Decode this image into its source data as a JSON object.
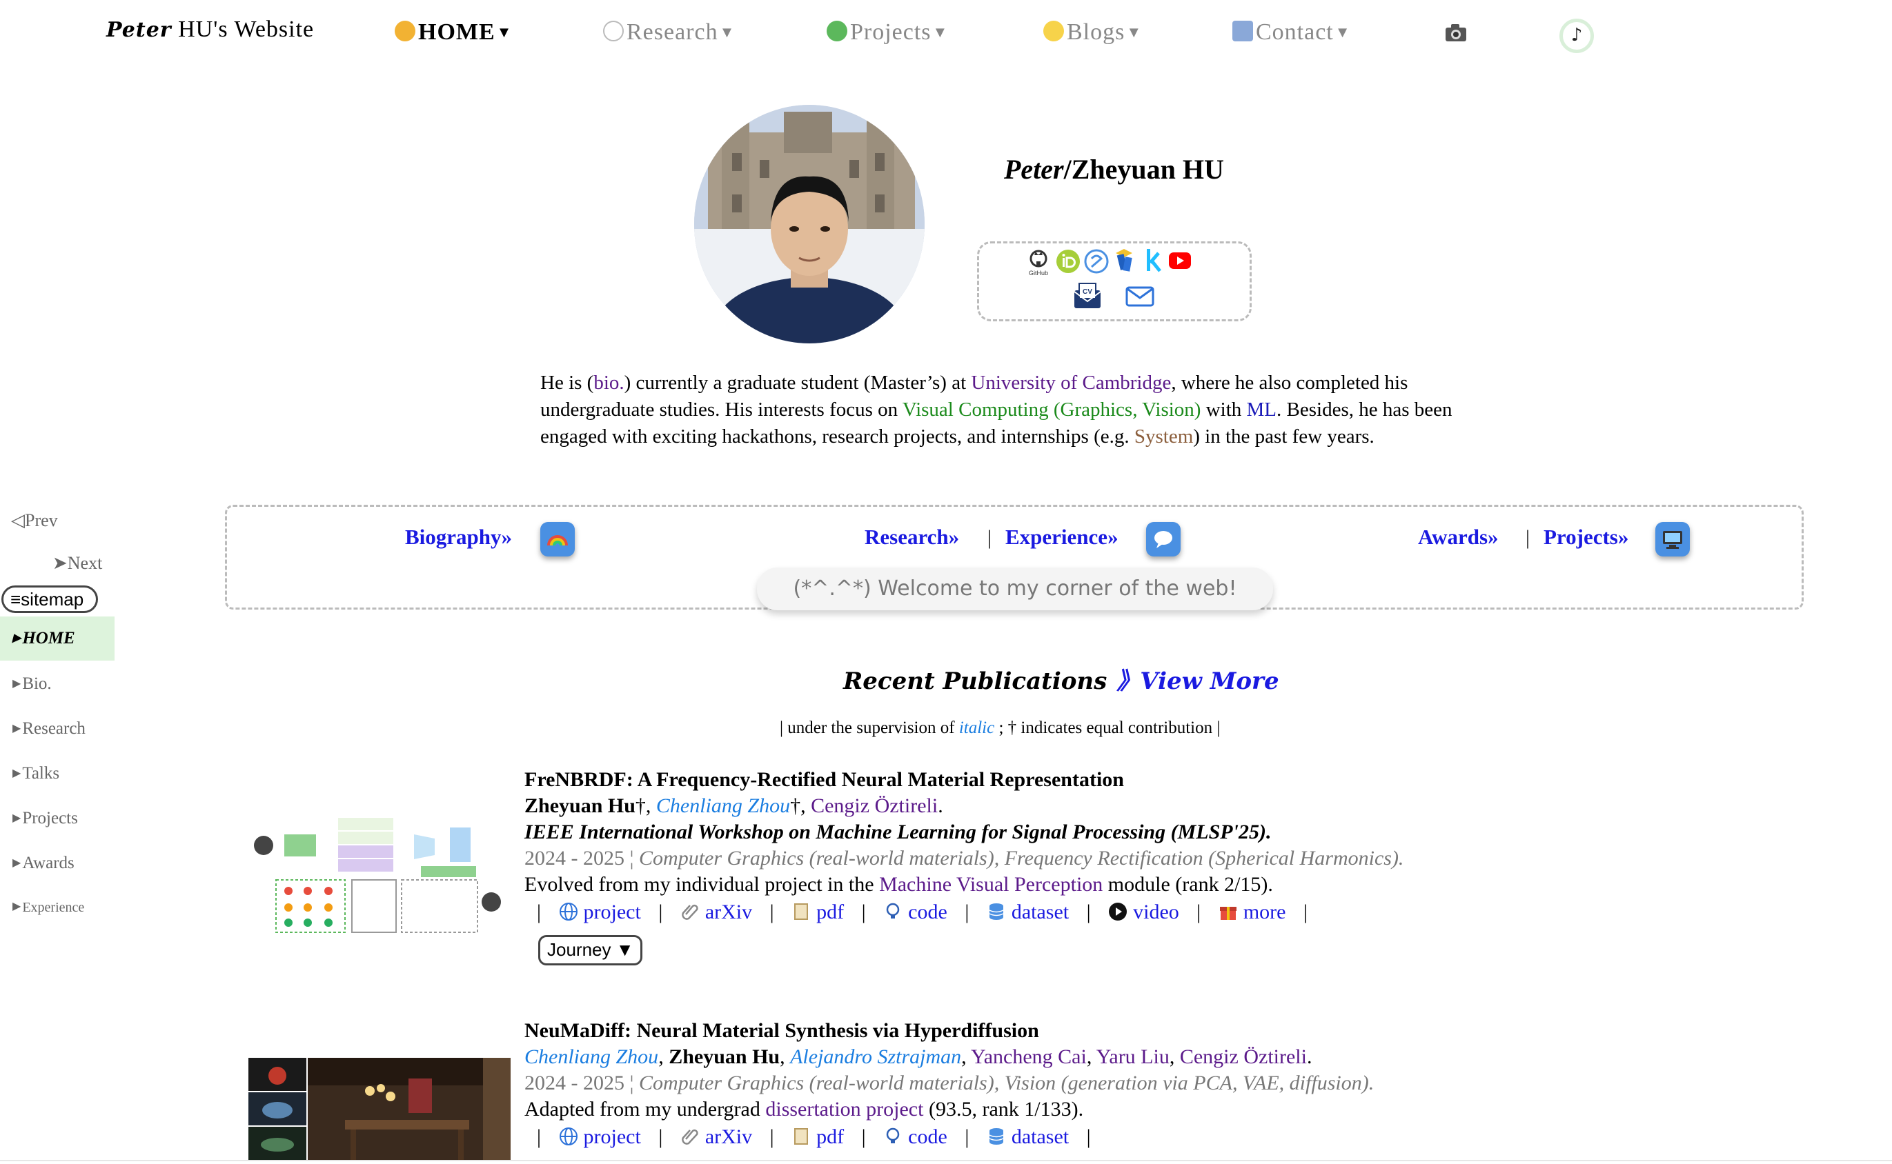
{
  "nav": {
    "brand_first": "Peter",
    "brand_rest": " HU's Website",
    "items": [
      {
        "label": "HOME"
      },
      {
        "label": "Research"
      },
      {
        "label": "Projects"
      },
      {
        "label": "Blogs"
      },
      {
        "label": "Contact"
      }
    ],
    "music_glyph": "♪"
  },
  "sidebar": {
    "prev": "◁Prev",
    "next": "➤Next",
    "sitemap": "≡sitemap",
    "items": [
      {
        "label": "HOME"
      },
      {
        "label": "Bio."
      },
      {
        "label": "Research"
      },
      {
        "label": "Talks"
      },
      {
        "label": "Projects"
      },
      {
        "label": "Awards"
      },
      {
        "label": "Experience"
      }
    ]
  },
  "profile": {
    "name_italic": "Peter",
    "name_rest": "/Zheyuan HU",
    "github_caption": "GitHub"
  },
  "bio": {
    "p1": "He is (",
    "bio_link": "bio.",
    "p2": ") currently a graduate student (Master’s) at ",
    "uni_link": "University of Cambridge",
    "p3": ", where he also completed his undergraduate studies. His interests focus on ",
    "vc_link": "Visual Computing (Graphics, Vision)",
    "p4": " with ",
    "ml_link": "ML",
    "p5": ". Besides, he has been engaged with exciting hackathons, research projects, and internships (e.g. ",
    "sys_link": "System",
    "p6": ") in the past few years."
  },
  "sections": {
    "biography": "Biography»",
    "research": "Research»",
    "experience": "Experience»",
    "awards": "Awards»",
    "projects": "Projects»",
    "separator": "|",
    "welcome": "(*^.^*) Welcome to my corner of the web!"
  },
  "publications": {
    "heading": "Recent Publications",
    "view_more": "》View More",
    "note_pre": "| under the supervision of ",
    "note_italic": "italic",
    "note_post": " ; † indicates equal contribution |",
    "items": [
      {
        "title": "FreNBRDF: A Frequency-Rectified Neural Material Representation",
        "authors": [
          {
            "name": "Zheyuan Hu",
            "style": "self"
          },
          {
            "name": "Chenliang Zhou",
            "style": "italic"
          },
          {
            "name": "Cengiz Öztireli",
            "style": "plain"
          }
        ],
        "venue": "IEEE International Workshop on Machine Learning for Signal Processing (MLSP'25).",
        "years": "2024 - 2025",
        "topics": "Computer Graphics (real-world materials), Frequency Rectification (Spherical Harmonics).",
        "desc_pre": "Evolved from my individual project in the ",
        "desc_link": "Machine Visual Perception",
        "desc_post": " module (rank 2/15).",
        "links": [
          "project",
          "arXiv",
          "pdf",
          "code",
          "dataset",
          "video",
          "more"
        ],
        "journey": "Journey ▼"
      },
      {
        "title": "NeuMaDiff: Neural Material Synthesis via Hyperdiffusion",
        "authors": [
          {
            "name": "Chenliang Zhou",
            "style": "italic"
          },
          {
            "name": "Zheyuan Hu",
            "style": "self"
          },
          {
            "name": "Alejandro Sztrajman",
            "style": "italic"
          },
          {
            "name": "Yancheng Cai",
            "style": "plain"
          },
          {
            "name": "Yaru Liu",
            "style": "plain"
          },
          {
            "name": "Cengiz Öztireli",
            "style": "plain"
          }
        ],
        "years": "2024 - 2025",
        "topics": "Computer Graphics (real-world materials), Vision (generation via PCA, VAE, diffusion).",
        "desc_pre": "Adapted from my undergrad ",
        "desc_link": "dissertation project",
        "desc_post": " (93.5, rank 1/133).",
        "links": [
          "project",
          "arXiv",
          "pdf",
          "code",
          "dataset"
        ]
      }
    ]
  }
}
